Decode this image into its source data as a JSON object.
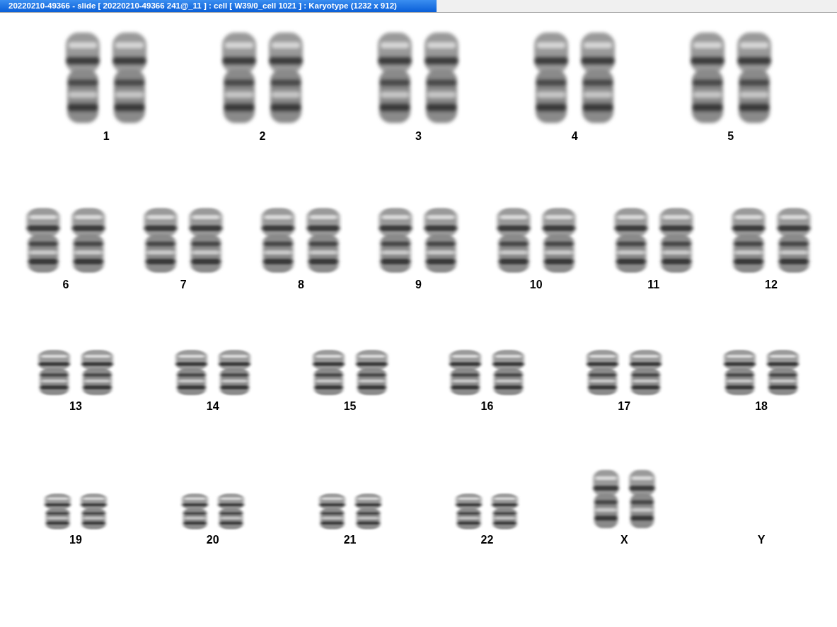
{
  "window": {
    "title": "20220210-49366 - slide [ 20220210-49366 241@_11 ] : cell [ W39/0_cell 1021 ] : Karyotype  (1232 x 912)"
  },
  "rows": [
    {
      "groups": [
        {
          "label": "1",
          "present": true
        },
        {
          "label": "2",
          "present": true
        },
        {
          "label": "3",
          "present": true
        },
        {
          "label": "4",
          "present": true
        },
        {
          "label": "5",
          "present": true
        }
      ]
    },
    {
      "groups": [
        {
          "label": "6",
          "present": true
        },
        {
          "label": "7",
          "present": true
        },
        {
          "label": "8",
          "present": true
        },
        {
          "label": "9",
          "present": true
        },
        {
          "label": "10",
          "present": true
        },
        {
          "label": "11",
          "present": true
        },
        {
          "label": "12",
          "present": true
        }
      ]
    },
    {
      "groups": [
        {
          "label": "13",
          "present": true
        },
        {
          "label": "14",
          "present": true
        },
        {
          "label": "15",
          "present": true
        },
        {
          "label": "16",
          "present": true
        },
        {
          "label": "17",
          "present": true
        },
        {
          "label": "18",
          "present": true
        }
      ]
    },
    {
      "groups": [
        {
          "label": "19",
          "present": true
        },
        {
          "label": "20",
          "present": true
        },
        {
          "label": "21",
          "present": true
        },
        {
          "label": "22",
          "present": true
        },
        {
          "label": "X",
          "present": true
        },
        {
          "label": "Y",
          "present": false
        }
      ]
    }
  ]
}
